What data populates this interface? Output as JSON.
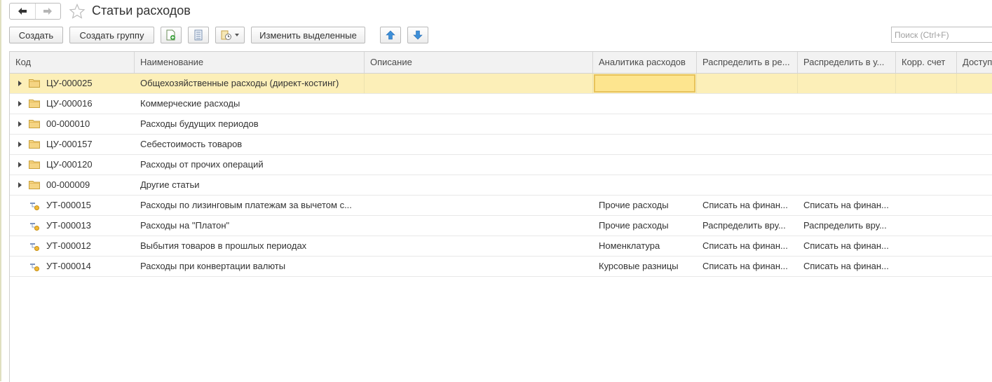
{
  "window": {
    "title": "Статьи расходов"
  },
  "toolbar": {
    "create_label": "Создать",
    "create_group_label": "Создать группу",
    "edit_selected_label": "Изменить выделенные",
    "search_placeholder": "Поиск (Ctrl+F)"
  },
  "columns": [
    "Код",
    "Наименование",
    "Описание",
    "Аналитика расходов",
    "Распределить в ре...",
    "Распределить в у...",
    "Корр. счет",
    "Доступ..."
  ],
  "rows": [
    {
      "type": "group",
      "code": "ЦУ-000025",
      "name": "Общехозяйственные расходы (директ-костинг)",
      "description": "",
      "analytics": "",
      "dist1": "",
      "dist2": "",
      "acct": "",
      "access": ""
    },
    {
      "type": "group",
      "code": "ЦУ-000016",
      "name": "Коммерческие расходы",
      "description": "",
      "analytics": "",
      "dist1": "",
      "dist2": "",
      "acct": "",
      "access": ""
    },
    {
      "type": "group",
      "code": "00-000010",
      "name": "Расходы будущих периодов",
      "description": "",
      "analytics": "",
      "dist1": "",
      "dist2": "",
      "acct": "",
      "access": ""
    },
    {
      "type": "group",
      "code": "ЦУ-000157",
      "name": "Себестоимость товаров",
      "description": "",
      "analytics": "",
      "dist1": "",
      "dist2": "",
      "acct": "",
      "access": ""
    },
    {
      "type": "group",
      "code": "ЦУ-000120",
      "name": "Расходы от прочих операций",
      "description": "",
      "analytics": "",
      "dist1": "",
      "dist2": "",
      "acct": "",
      "access": ""
    },
    {
      "type": "group",
      "code": "00-000009",
      "name": "Другие статьи",
      "description": "",
      "analytics": "",
      "dist1": "",
      "dist2": "",
      "acct": "",
      "access": ""
    },
    {
      "type": "item",
      "code": "УТ-000015",
      "name": "Расходы по лизинговым платежам за вычетом с...",
      "description": "",
      "analytics": "Прочие расходы",
      "dist1": "Списать на финан...",
      "dist2": "Списать на финан...",
      "acct": "",
      "access": ""
    },
    {
      "type": "item",
      "code": "УТ-000013",
      "name": "Расходы на \"Платон\"",
      "description": "",
      "analytics": "Прочие расходы",
      "dist1": "Распределить вру...",
      "dist2": "Распределить вру...",
      "acct": "",
      "access": ""
    },
    {
      "type": "item",
      "code": "УТ-000012",
      "name": "Выбытия товаров в прошлых периодах",
      "description": "",
      "analytics": "Номенклатура",
      "dist1": "Списать на финан...",
      "dist2": "Списать на финан...",
      "acct": "",
      "access": ""
    },
    {
      "type": "item",
      "code": "УТ-000014",
      "name": "Расходы при конвертации валюты",
      "description": "",
      "analytics": "Курсовые разницы",
      "dist1": "Списать на финан...",
      "dist2": "Списать на финан...",
      "acct": "",
      "access": ""
    }
  ],
  "selected_row_index": 0,
  "colors": {
    "selected_row": "#fcefb8",
    "active_cell": "#fde58f",
    "folder": "#f0c75e"
  }
}
